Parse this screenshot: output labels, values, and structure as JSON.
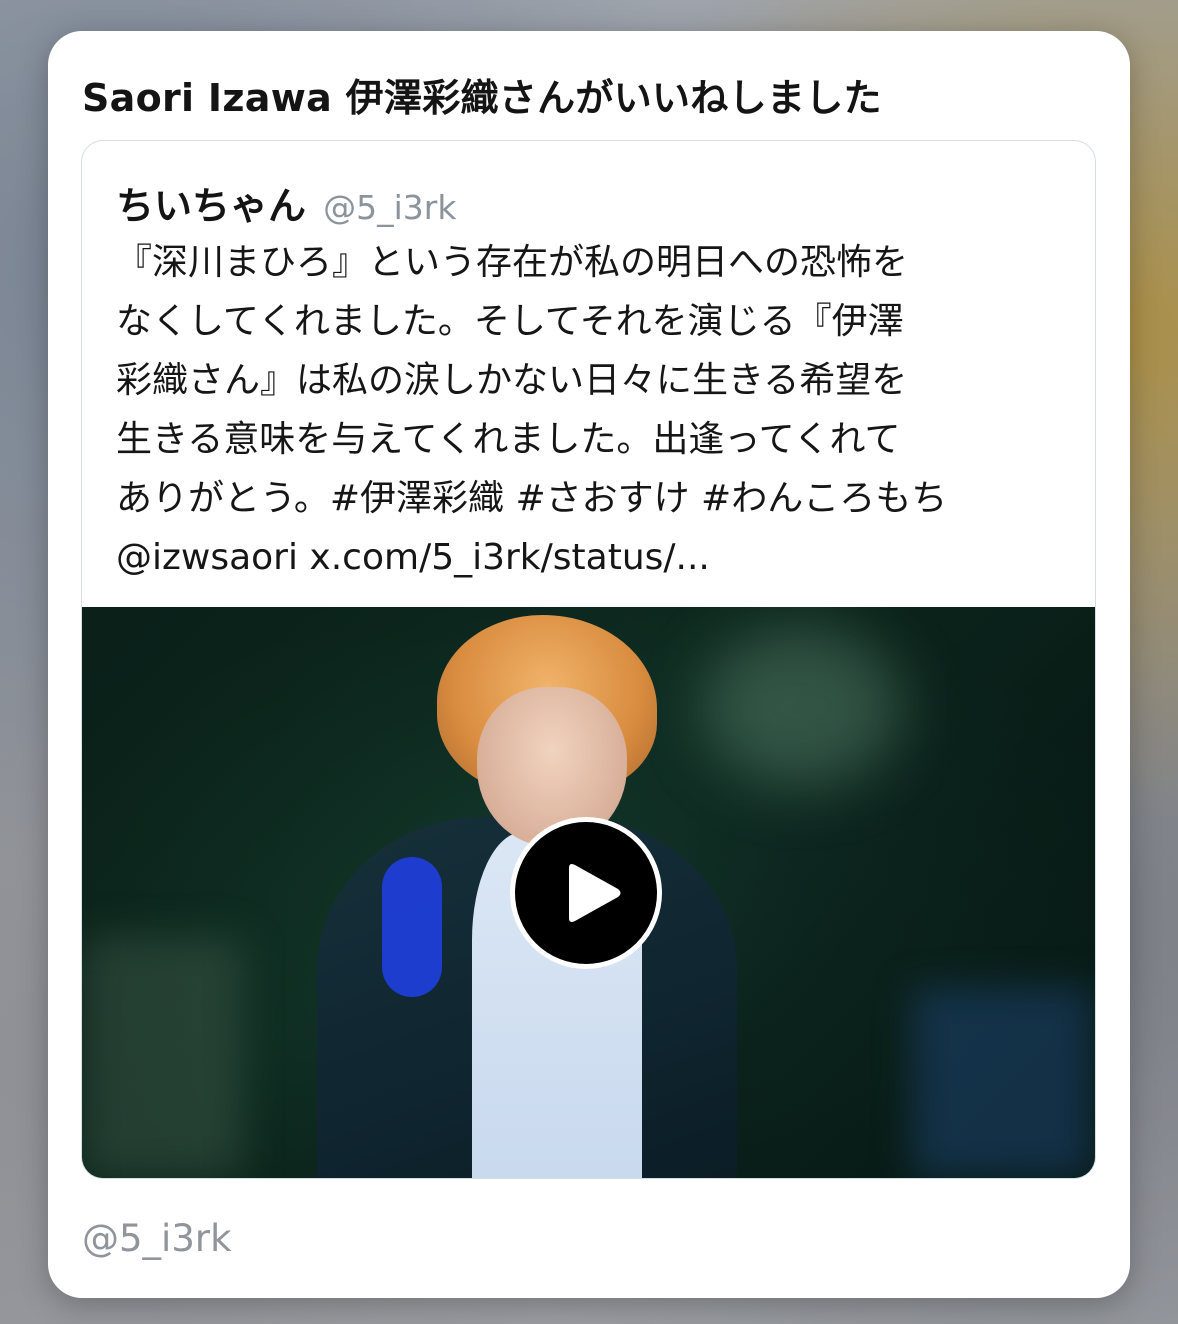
{
  "card": {
    "title": "Saori Izawa 伊澤彩織さんがいいねしました",
    "footer_handle": "@5_i3rk"
  },
  "tweet": {
    "author_name": "ちいちゃん",
    "author_handle": "@5_i3rk",
    "text_lines": [
      "『深川まひろ』という存在が私の明日への恐怖を",
      "なくしてくれました。そしてそれを演じる『伊澤",
      "彩織さん』は私の涙しかない日々に生きる希望を",
      "生きる意味を与えてくれました。出逢ってくれて",
      "ありがとう。#伊澤彩織 #さおすけ #わんころもち",
      "@izwsaori x.com/5_i3rk/status/..."
    ],
    "media": {
      "type": "video",
      "play_icon": "play-icon"
    }
  },
  "colors": {
    "card_background": "#ffffff",
    "text_primary": "#141414",
    "text_secondary": "#8b949c",
    "embed_border": "#d6dde3",
    "play_button": "#000000"
  }
}
